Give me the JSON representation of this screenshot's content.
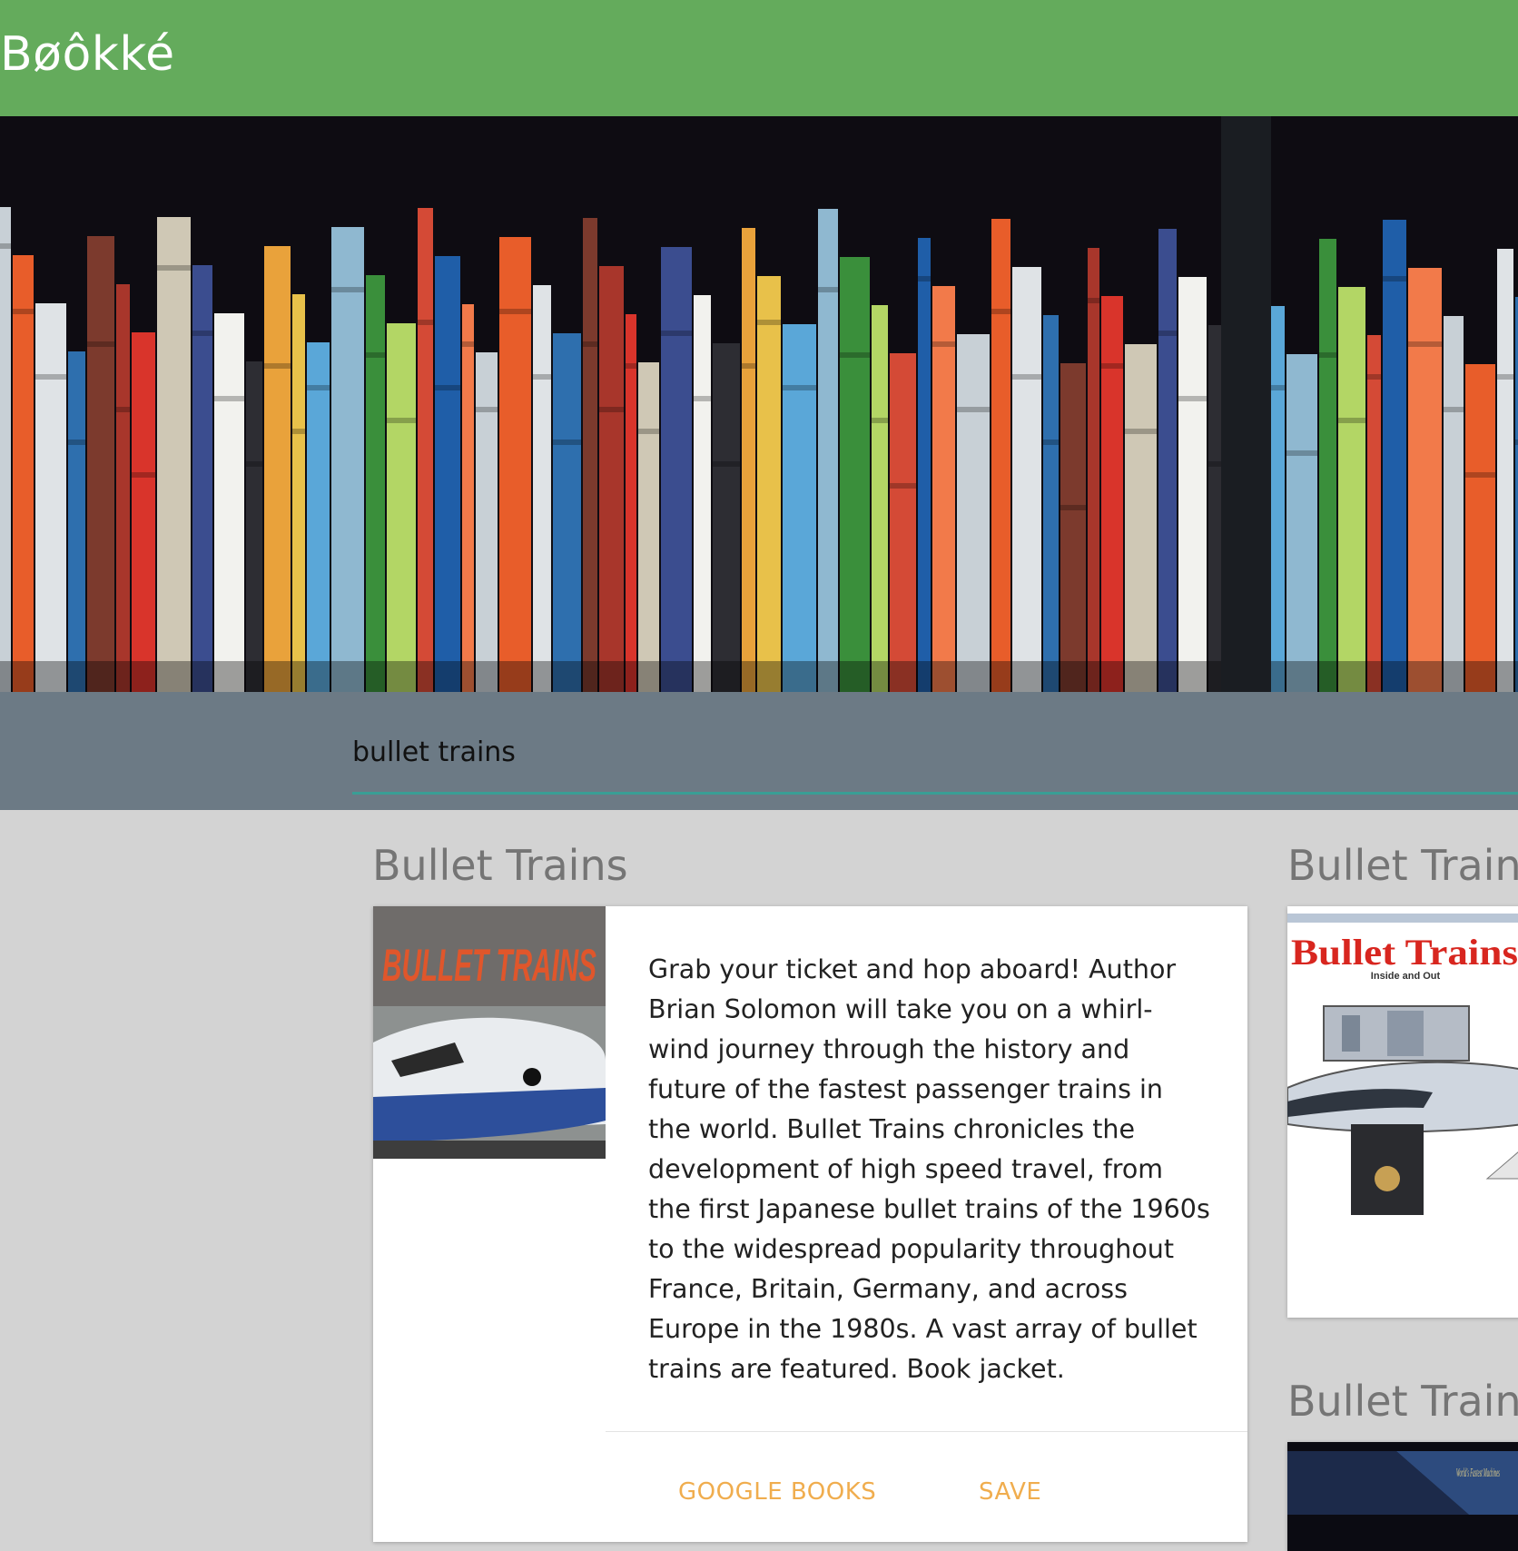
{
  "app": {
    "title": "Βøôkké"
  },
  "search": {
    "value": "bullet trains"
  },
  "results": [
    {
      "title": "Bullet Trains",
      "cover_text": "BULLET TRAINS",
      "description": "Grab your ticket and hop aboard! Author Brian Solomon will take you on a whirl-wind journey through the history and future of the fastest passenger trains in the world. Bullet Trains chronicles the development of high speed travel, from the first Japanese bullet trains of the 1960s to the widespread popularity throughout France, Britain, Germany, and across Europe in the 1980s. A vast array of bullet trains are featured. Book jacket.",
      "actions": {
        "google_books": "GOOGLE BOOKS",
        "save": "SAVE"
      }
    },
    {
      "title": "Bullet Trains",
      "cover_text": "Bullet Trains",
      "cover_subtitle": "Inside and Out"
    },
    {
      "title": "Bullet Trains",
      "cover_text": "World's Fastest Machines"
    }
  ],
  "colors": {
    "app_bar": "#64ab5c",
    "search_band": "#6c7a85",
    "search_underline": "#3a9e95",
    "page_bg": "#d3d3d3",
    "action_text": "#f0ad4e"
  }
}
